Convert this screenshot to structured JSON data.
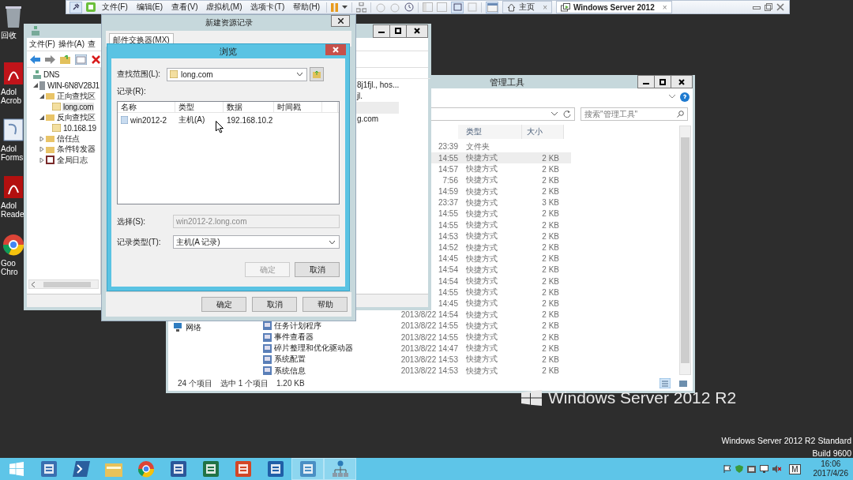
{
  "vm_toolbar": {
    "menus": [
      "文件(F)",
      "编辑(E)",
      "查看(V)",
      "虚拟机(M)",
      "选项卡(T)",
      "帮助(H)"
    ],
    "tabs": [
      {
        "label": "主页",
        "close": "×",
        "selected": false
      },
      {
        "label": "Windows Server 2012",
        "close": "×",
        "selected": true
      }
    ]
  },
  "desktop_icons": [
    {
      "kind": "recycle-bin",
      "lines": [
        "回收"
      ]
    },
    {
      "kind": "acrobat",
      "lines": [
        "Adol",
        "Acrob"
      ]
    },
    {
      "kind": "forms",
      "lines": [
        "Adol",
        "Forms"
      ]
    },
    {
      "kind": "reader",
      "lines": [
        "Adol",
        "Reade"
      ]
    },
    {
      "kind": "chrome",
      "lines": [
        "Goo",
        "Chro"
      ]
    }
  ],
  "dns_window": {
    "menus": [
      "文件(F)",
      "操作(A)",
      "查"
    ],
    "tree": [
      {
        "label": "DNS",
        "kind": "server",
        "selected": false,
        "children": [
          {
            "label": "WIN-6N8V28J1",
            "kind": "computer",
            "expanded": true,
            "selected": false,
            "children": [
              {
                "label": "正向查找区",
                "kind": "folder",
                "expanded": true,
                "selected": false,
                "children": [
                  {
                    "label": "long.com",
                    "kind": "zone",
                    "selected": true
                  }
                ]
              },
              {
                "label": "反向查找区",
                "kind": "folder",
                "expanded": true,
                "selected": false,
                "children": [
                  {
                    "label": "10.168.19",
                    "kind": "zone",
                    "selected": false
                  }
                ]
              },
              {
                "label": "信任点",
                "kind": "folder",
                "expanded": false,
                "selected": false
              },
              {
                "label": "条件转发器",
                "kind": "folder",
                "expanded": false,
                "selected": false
              },
              {
                "label": "全局日志",
                "kind": "log",
                "expanded": false,
                "selected": false
              }
            ]
          }
        ]
      }
    ],
    "list_rows": [
      {
        "text": "8j1fjl., hos...",
        "selected": false
      },
      {
        "text": "jl.",
        "selected": false
      },
      {
        "selected": true
      },
      {
        "text": "g.com",
        "selected": false
      }
    ]
  },
  "new_record_dialog": {
    "title": "新建资源记录",
    "tab": "邮件交换器(MX)",
    "buttons": [
      "确定",
      "取消",
      "帮助"
    ]
  },
  "browse_dialog": {
    "title": "浏览",
    "look_in_label": "查找范围(L):",
    "look_in_value": "long.com",
    "records_label": "记录(R):",
    "columns": [
      "名称",
      "类型",
      "数据",
      "时间戳"
    ],
    "rows": [
      {
        "cells": [
          "win2012-2",
          "主机(A)",
          "192.168.10.2"
        ],
        "selected": false
      }
    ],
    "selection_label": "选择(S):",
    "selection_value": "win2012-2.long.com",
    "selection_disabled": true,
    "type_label": "记录类型(T):",
    "type_value": "主机(A 记录)",
    "buttons": [
      {
        "label": "确定",
        "disabled": true
      },
      {
        "label": "取消",
        "disabled": false
      }
    ]
  },
  "explorer": {
    "title": "管理工具",
    "search_placeholder": "搜索\"管理工具\"",
    "columns": [
      "类型",
      "大小"
    ],
    "nav": [
      {
        "label": "网络"
      }
    ],
    "rows": [
      {
        "date": "23:39",
        "type": "文件夹",
        "selected": false
      },
      {
        "date": "14:55",
        "type": "快捷方式",
        "size": "2 KB",
        "selected": true
      },
      {
        "date": "14:57",
        "type": "快捷方式",
        "size": "2 KB",
        "selected": false
      },
      {
        "date": "7:56",
        "type": "快捷方式",
        "size": "2 KB",
        "selected": false
      },
      {
        "date": "14:59",
        "type": "快捷方式",
        "size": "2 KB",
        "selected": false
      },
      {
        "date": "23:37",
        "type": "快捷方式",
        "size": "3 KB",
        "selected": false
      },
      {
        "date": "14:55",
        "type": "快捷方式",
        "size": "2 KB",
        "selected": false
      },
      {
        "date": "14:55",
        "type": "快捷方式",
        "size": "2 KB",
        "selected": false
      },
      {
        "date": "14:53",
        "type": "快捷方式",
        "size": "2 KB",
        "selected": false
      },
      {
        "date": "14:52",
        "type": "快捷方式",
        "size": "2 KB",
        "selected": false
      },
      {
        "date": "14:45",
        "type": "快捷方式",
        "size": "2 KB",
        "selected": false
      },
      {
        "date": "14:54",
        "type": "快捷方式",
        "size": "2 KB",
        "selected": false
      },
      {
        "date": "14:54",
        "type": "快捷方式",
        "size": "2 KB",
        "selected": false
      },
      {
        "date": "14:55",
        "type": "快捷方式",
        "size": "2 KB",
        "selected": false
      },
      {
        "date": "14:45",
        "type": "快捷方式",
        "size": "2 KB",
        "selected": false
      },
      {
        "date": "2013/8/22 14:54",
        "type": "快捷方式",
        "size": "2 KB",
        "selected": false
      },
      {
        "name": "任务计划程序",
        "date": "2013/8/22 14:55",
        "type": "快捷方式",
        "size": "2 KB",
        "selected": false
      },
      {
        "name": "事件查看器",
        "date": "2013/8/22 14:55",
        "type": "快捷方式",
        "size": "2 KB",
        "selected": false
      },
      {
        "name": "碎片整理和优化驱动器",
        "date": "2013/8/22 14:47",
        "type": "快捷方式",
        "size": "2 KB",
        "selected": false
      },
      {
        "name": "系统配置",
        "date": "2013/8/22 14:53",
        "type": "快捷方式",
        "size": "2 KB",
        "selected": false
      },
      {
        "name": "系统信息",
        "date": "2013/8/22 14:53",
        "type": "快捷方式",
        "size": "2 KB",
        "selected": false
      }
    ],
    "status": [
      "24 个项目",
      "选中 1 个项目",
      "1.20 KB"
    ]
  },
  "os_branding": {
    "logo_text": "Windows Server 2012 R2",
    "edition": "Windows Server 2012 R2 Standard",
    "build": "Build 9600"
  },
  "taskbar": {
    "items": [
      {
        "kind": "server-manager",
        "selected": false
      },
      {
        "kind": "powershell",
        "selected": false
      },
      {
        "kind": "folder",
        "selected": false
      },
      {
        "kind": "chrome",
        "selected": false
      },
      {
        "kind": "word",
        "selected": false
      },
      {
        "kind": "excel",
        "selected": false
      },
      {
        "kind": "powerpoint",
        "selected": false
      },
      {
        "kind": "computer",
        "selected": false
      },
      {
        "kind": "monitor",
        "selected": true
      },
      {
        "kind": "network",
        "selected": true
      }
    ],
    "tray_letter": "M",
    "time": "16:06",
    "date": "2017/4/26"
  }
}
